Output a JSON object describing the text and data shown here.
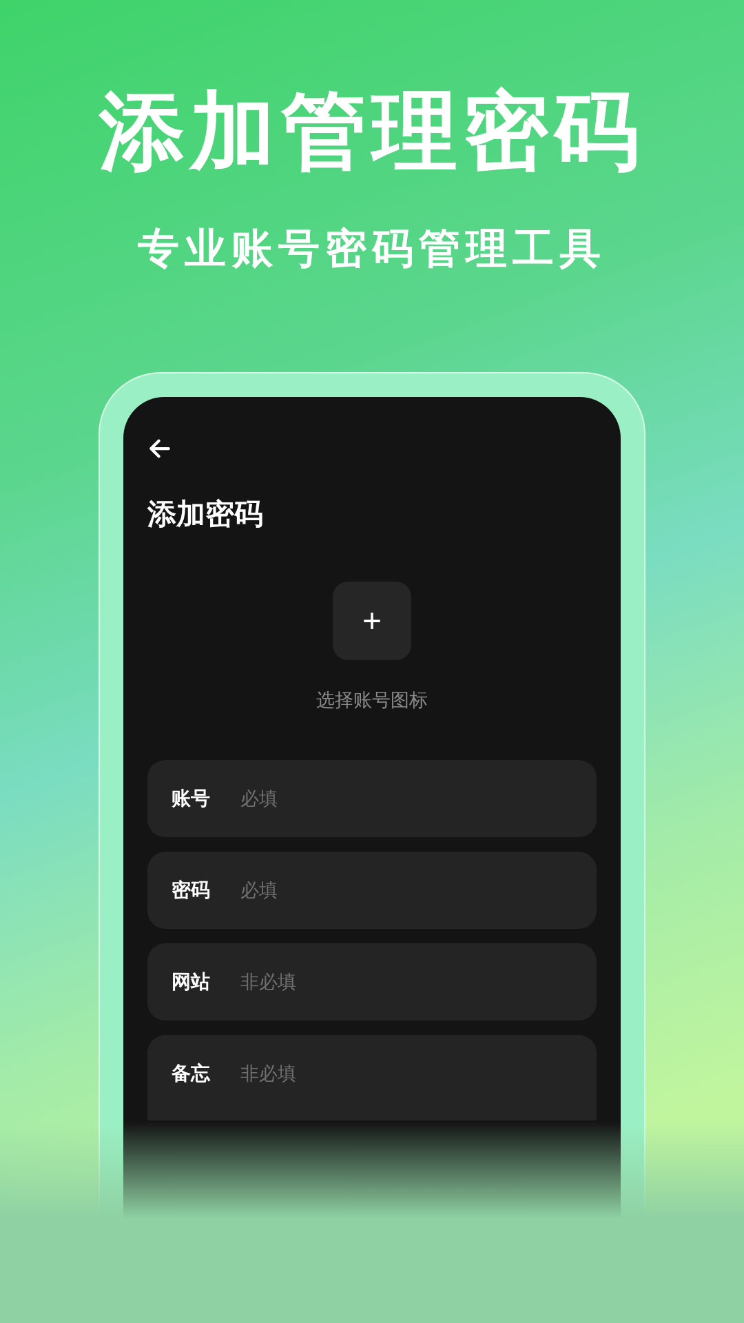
{
  "headline": "添加管理密码",
  "subheadline": "专业账号密码管理工具",
  "screen": {
    "title": "添加密码",
    "icon_picker": {
      "button": "+",
      "label": "选择账号图标"
    },
    "fields": [
      {
        "label": "账号",
        "placeholder": "必填",
        "kind": "line"
      },
      {
        "label": "密码",
        "placeholder": "必填",
        "kind": "line"
      },
      {
        "label": "网站",
        "placeholder": "非必填",
        "kind": "line"
      },
      {
        "label": "备忘",
        "placeholder": "非必填",
        "kind": "area"
      }
    ]
  }
}
